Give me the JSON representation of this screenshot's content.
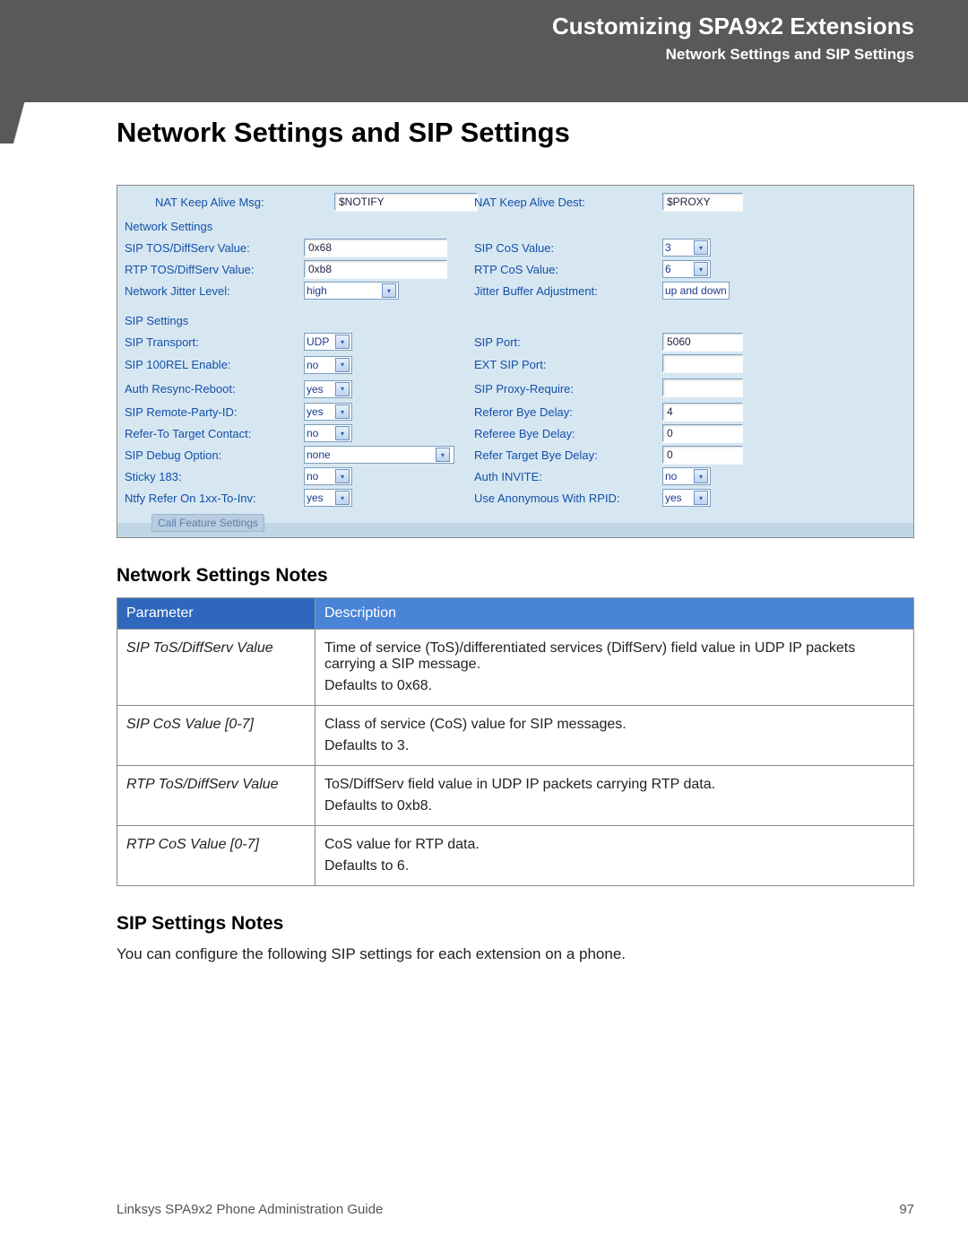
{
  "header": {
    "title": "Customizing SPA9x2 Extensions",
    "subtitle": "Network Settings and SIP Settings"
  },
  "page_title": "Network Settings and SIP Settings",
  "panel": {
    "nat_msg_label": "NAT Keep Alive Msg:",
    "nat_msg_value": "$NOTIFY",
    "nat_dest_label": "NAT Keep Alive Dest:",
    "nat_dest_value": "$PROXY",
    "network_settings_heading": "Network Settings",
    "sip_tos_label": "SIP TOS/DiffServ Value:",
    "sip_tos_value": "0x68",
    "sip_cos_label": "SIP CoS Value:",
    "sip_cos_value": "3",
    "rtp_tos_label": "RTP TOS/DiffServ Value:",
    "rtp_tos_value": "0xb8",
    "rtp_cos_label": "RTP CoS Value:",
    "rtp_cos_value": "6",
    "jitter_level_label": "Network Jitter Level:",
    "jitter_level_value": "high",
    "jitter_adjust_label": "Jitter Buffer Adjustment:",
    "jitter_adjust_value": "up and down",
    "sip_settings_heading": "SIP Settings",
    "sip_transport_label": "SIP Transport:",
    "sip_transport_value": "UDP",
    "sip_port_label": "SIP Port:",
    "sip_port_value": "5060",
    "sip_100rel_label": "SIP 100REL Enable:",
    "sip_100rel_value": "no",
    "ext_sip_port_label": "EXT SIP Port:",
    "ext_sip_port_value": "",
    "auth_resync_label": "Auth Resync-Reboot:",
    "auth_resync_value": "yes",
    "sip_proxy_require_label": "SIP Proxy-Require:",
    "sip_proxy_require_value": "",
    "sip_remote_party_label": "SIP Remote-Party-ID:",
    "sip_remote_party_value": "yes",
    "referor_bye_label": "Referor Bye Delay:",
    "referor_bye_value": "4",
    "refer_to_target_label": "Refer-To Target Contact:",
    "refer_to_target_value": "no",
    "referee_bye_label": "Referee Bye Delay:",
    "referee_bye_value": "0",
    "sip_debug_label": "SIP Debug Option:",
    "sip_debug_value": "none",
    "refer_target_bye_label": "Refer Target Bye Delay:",
    "refer_target_bye_value": "0",
    "sticky183_label": "Sticky 183:",
    "sticky183_value": "no",
    "auth_invite_label": "Auth INVITE:",
    "auth_invite_value": "no",
    "ntfy_refer_label": "Ntfy Refer On 1xx-To-Inv:",
    "ntfy_refer_value": "yes",
    "use_anon_rpid_label": "Use Anonymous With RPID:",
    "use_anon_rpid_value": "yes",
    "call_feature_tab": "Call Feature Settings"
  },
  "network_notes_heading": "Network Settings Notes",
  "notes_table": {
    "col1": "Parameter",
    "col2": "Description",
    "rows": [
      {
        "param": "SIP ToS/DiffServ Value",
        "desc1": "Time of service (ToS)/differentiated services (DiffServ) field value in UDP IP packets carrying a SIP message.",
        "desc2": "Defaults to 0x68."
      },
      {
        "param": "SIP CoS Value [0-7]",
        "desc1": "Class of service (CoS) value for SIP messages.",
        "desc2": "Defaults to 3."
      },
      {
        "param": "RTP ToS/DiffServ Value",
        "desc1": "ToS/DiffServ field value in UDP IP packets carrying RTP data.",
        "desc2": "Defaults to 0xb8."
      },
      {
        "param": "RTP CoS Value [0-7]",
        "desc1": "CoS value for RTP data.",
        "desc2": "Defaults to 6."
      }
    ]
  },
  "sip_notes_heading": "SIP Settings Notes",
  "sip_notes_body": "You can configure the following SIP settings for each extension on a phone.",
  "footer": {
    "left": "Linksys SPA9x2 Phone Administration Guide",
    "right": "97"
  }
}
